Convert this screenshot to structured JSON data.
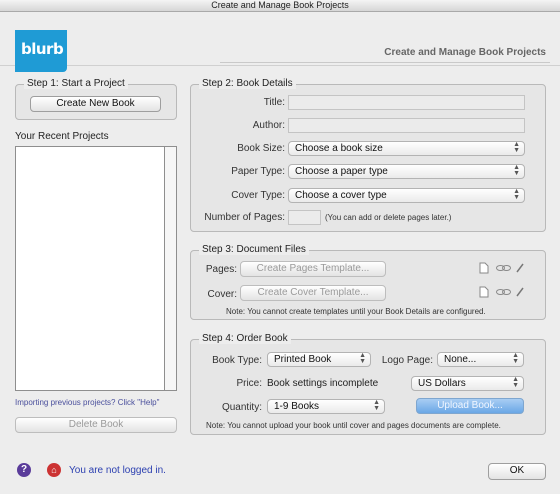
{
  "window": {
    "title": "Create and Manage Book Projects"
  },
  "header": {
    "logo": "blurb",
    "title": "Create and Manage Book Projects"
  },
  "step1": {
    "legend": "Step 1: Start a Project",
    "create_button": "Create New Book",
    "recent_label": "Your Recent Projects",
    "import_link": "Importing previous projects? Click \"Help\"",
    "delete_button": "Delete Book"
  },
  "step2": {
    "legend": "Step 2: Book Details",
    "title_label": "Title:",
    "author_label": "Author:",
    "book_size_label": "Book Size:",
    "book_size_value": "Choose a book size",
    "paper_type_label": "Paper Type:",
    "paper_type_value": "Choose a paper type",
    "cover_type_label": "Cover Type:",
    "cover_type_value": "Choose a cover type",
    "pages_label": "Number of Pages:",
    "pages_note": "(You can add or delete pages later.)"
  },
  "step3": {
    "legend": "Step 3: Document Files",
    "pages_label": "Pages:",
    "pages_button": "Create Pages Template...",
    "cover_label": "Cover:",
    "cover_button": "Create Cover Template...",
    "note": "Note: You cannot create templates until your Book Details are configured."
  },
  "step4": {
    "legend": "Step 4: Order Book",
    "book_type_label": "Book Type:",
    "book_type_value": "Printed Book",
    "logo_page_label": "Logo Page:",
    "logo_page_value": "None...",
    "price_label": "Price:",
    "price_value": "Book settings incomplete",
    "currency_value": "US Dollars",
    "quantity_label": "Quantity:",
    "quantity_value": "1-9 Books",
    "upload_button": "Upload Book...",
    "note": "Note: You cannot upload your book until cover and pages documents are complete."
  },
  "status": {
    "help_icon": "?",
    "login_text": "You are not logged in.",
    "ok_button": "OK"
  },
  "icons": {
    "help": "question-mark-icon",
    "home": "home-icon",
    "file": "file-icon",
    "link": "chain-link-icon",
    "edit": "pencil-icon"
  },
  "colors": {
    "brand": "#1f9bd5",
    "link": "#4a4f9c",
    "status_text": "#2b3fb0",
    "upload": "#6aa7e6"
  }
}
